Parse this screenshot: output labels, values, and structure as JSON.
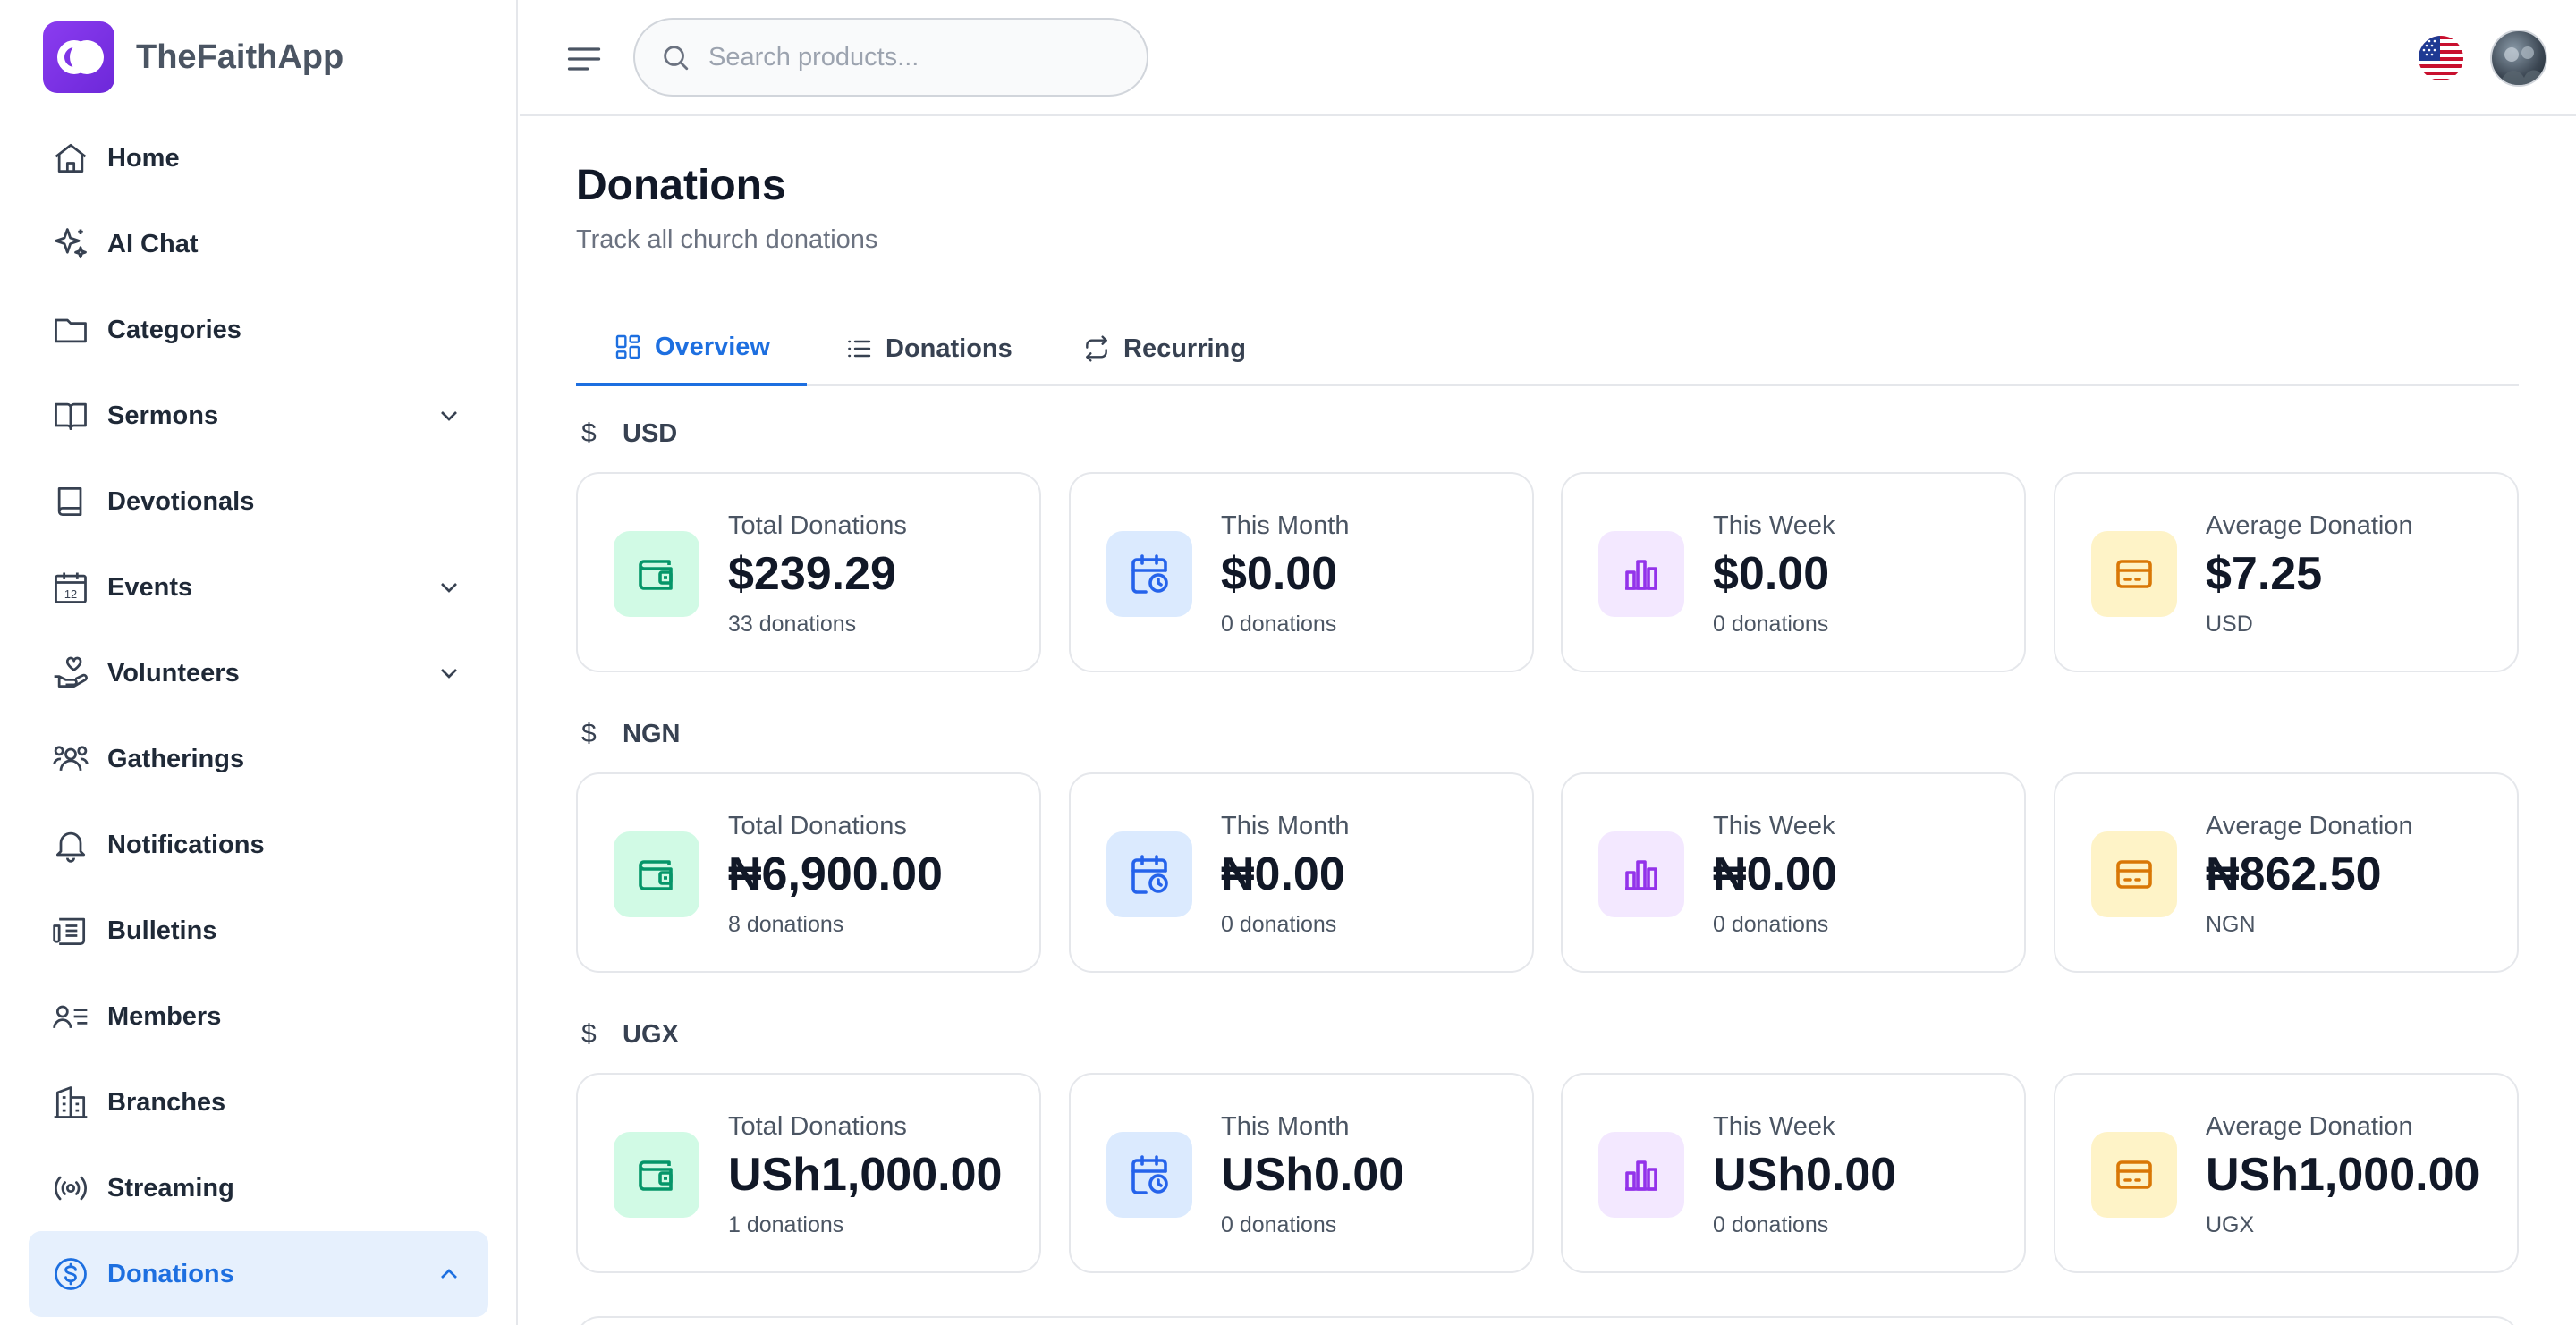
{
  "app": {
    "name": "TheFaithApp"
  },
  "sidebar": {
    "items": [
      {
        "label": "Home",
        "icon": "home-icon"
      },
      {
        "label": "AI Chat",
        "icon": "sparkles-icon"
      },
      {
        "label": "Categories",
        "icon": "folder-icon"
      },
      {
        "label": "Sermons",
        "icon": "book-open-icon",
        "expandable": true
      },
      {
        "label": "Devotionals",
        "icon": "book-icon"
      },
      {
        "label": "Events",
        "icon": "calendar-icon",
        "expandable": true
      },
      {
        "label": "Volunteers",
        "icon": "hand-heart-icon",
        "expandable": true
      },
      {
        "label": "Gatherings",
        "icon": "users-icon"
      },
      {
        "label": "Notifications",
        "icon": "bell-icon"
      },
      {
        "label": "Bulletins",
        "icon": "newspaper-icon"
      },
      {
        "label": "Members",
        "icon": "user-list-icon"
      },
      {
        "label": "Branches",
        "icon": "building-icon"
      },
      {
        "label": "Streaming",
        "icon": "broadcast-icon"
      },
      {
        "label": "Donations",
        "icon": "dollar-circle-icon",
        "active": true,
        "expanded": true
      }
    ],
    "calendar_icon_text": "12"
  },
  "header": {
    "search_placeholder": "Search products...",
    "language_flag": "us-flag-icon"
  },
  "page": {
    "title": "Donations",
    "subtitle": "Track all church donations"
  },
  "tabs": [
    {
      "label": "Overview",
      "icon": "layout-grid-icon",
      "active": true
    },
    {
      "label": "Donations",
      "icon": "list-icon"
    },
    {
      "label": "Recurring",
      "icon": "repeat-icon"
    }
  ],
  "stats": [
    {
      "currency": "USD",
      "symbol": "$",
      "cards": [
        {
          "label": "Total Donations",
          "value": "$239.29",
          "sub": "33 donations"
        },
        {
          "label": "This Month",
          "value": "$0.00",
          "sub": "0 donations"
        },
        {
          "label": "This Week",
          "value": "$0.00",
          "sub": "0 donations"
        },
        {
          "label": "Average Donation",
          "value": "$7.25",
          "sub": "USD"
        }
      ]
    },
    {
      "currency": "NGN",
      "symbol": "$",
      "cards": [
        {
          "label": "Total Donations",
          "value": "₦6,900.00",
          "sub": "8 donations"
        },
        {
          "label": "This Month",
          "value": "₦0.00",
          "sub": "0 donations"
        },
        {
          "label": "This Week",
          "value": "₦0.00",
          "sub": "0 donations"
        },
        {
          "label": "Average Donation",
          "value": "₦862.50",
          "sub": "NGN"
        }
      ]
    },
    {
      "currency": "UGX",
      "symbol": "$",
      "cards": [
        {
          "label": "Total Donations",
          "value": "USh1,000.00",
          "sub": "1 donations"
        },
        {
          "label": "This Month",
          "value": "USh0.00",
          "sub": "0 donations"
        },
        {
          "label": "This Week",
          "value": "USh0.00",
          "sub": "0 donations"
        },
        {
          "label": "Average Donation",
          "value": "USh1,000.00",
          "sub": "UGX"
        }
      ]
    }
  ],
  "card_icons": [
    "wallet-icon",
    "calendar-clock-icon",
    "bar-chart-icon",
    "credit-card-icon"
  ],
  "colors": {
    "accent": "#1d6fe0",
    "brand": "#7c3aed",
    "green": "#059669",
    "blue": "#2563eb",
    "purple": "#9333ea",
    "amber": "#d97706"
  }
}
